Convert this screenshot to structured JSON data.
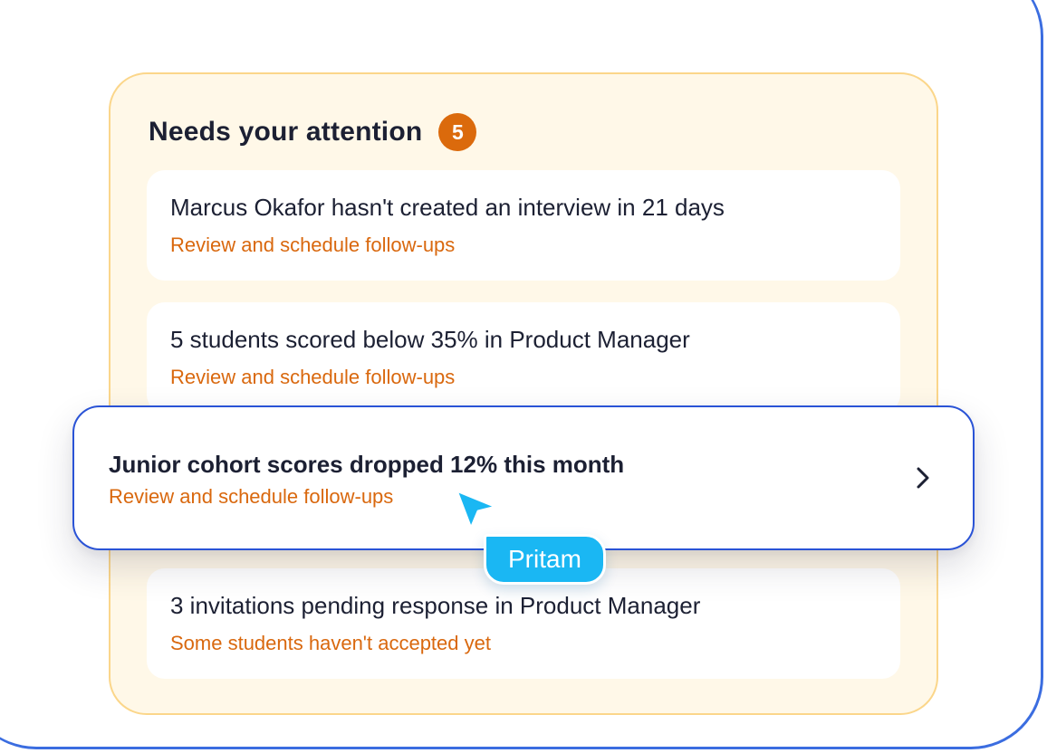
{
  "panel": {
    "title": "Needs your attention",
    "count": "5"
  },
  "alerts": [
    {
      "title": "Marcus Okafor hasn't created an interview in 21 days",
      "subtitle": "Review and schedule follow-ups"
    },
    {
      "title": "5 students scored below 35% in Product Manager",
      "subtitle": "Review and schedule follow-ups"
    },
    {
      "title": "Junior cohort scores dropped 12% this month",
      "subtitle": "Review and schedule follow-ups"
    },
    {
      "title": "3 invitations pending response in Product Manager",
      "subtitle": "Some students haven't accepted yet"
    }
  ],
  "cursor": {
    "user_name": "Pritam",
    "icon": "cursor-arrow-icon"
  },
  "icons": {
    "chevron": "chevron-right-icon"
  },
  "colors": {
    "panel_bg": "#fff8e8",
    "panel_border": "#fbd68a",
    "badge": "#db6a0c",
    "subtitle": "#d9680e",
    "highlight_border": "#2a53d6",
    "cursor": "#1ab7f3"
  }
}
